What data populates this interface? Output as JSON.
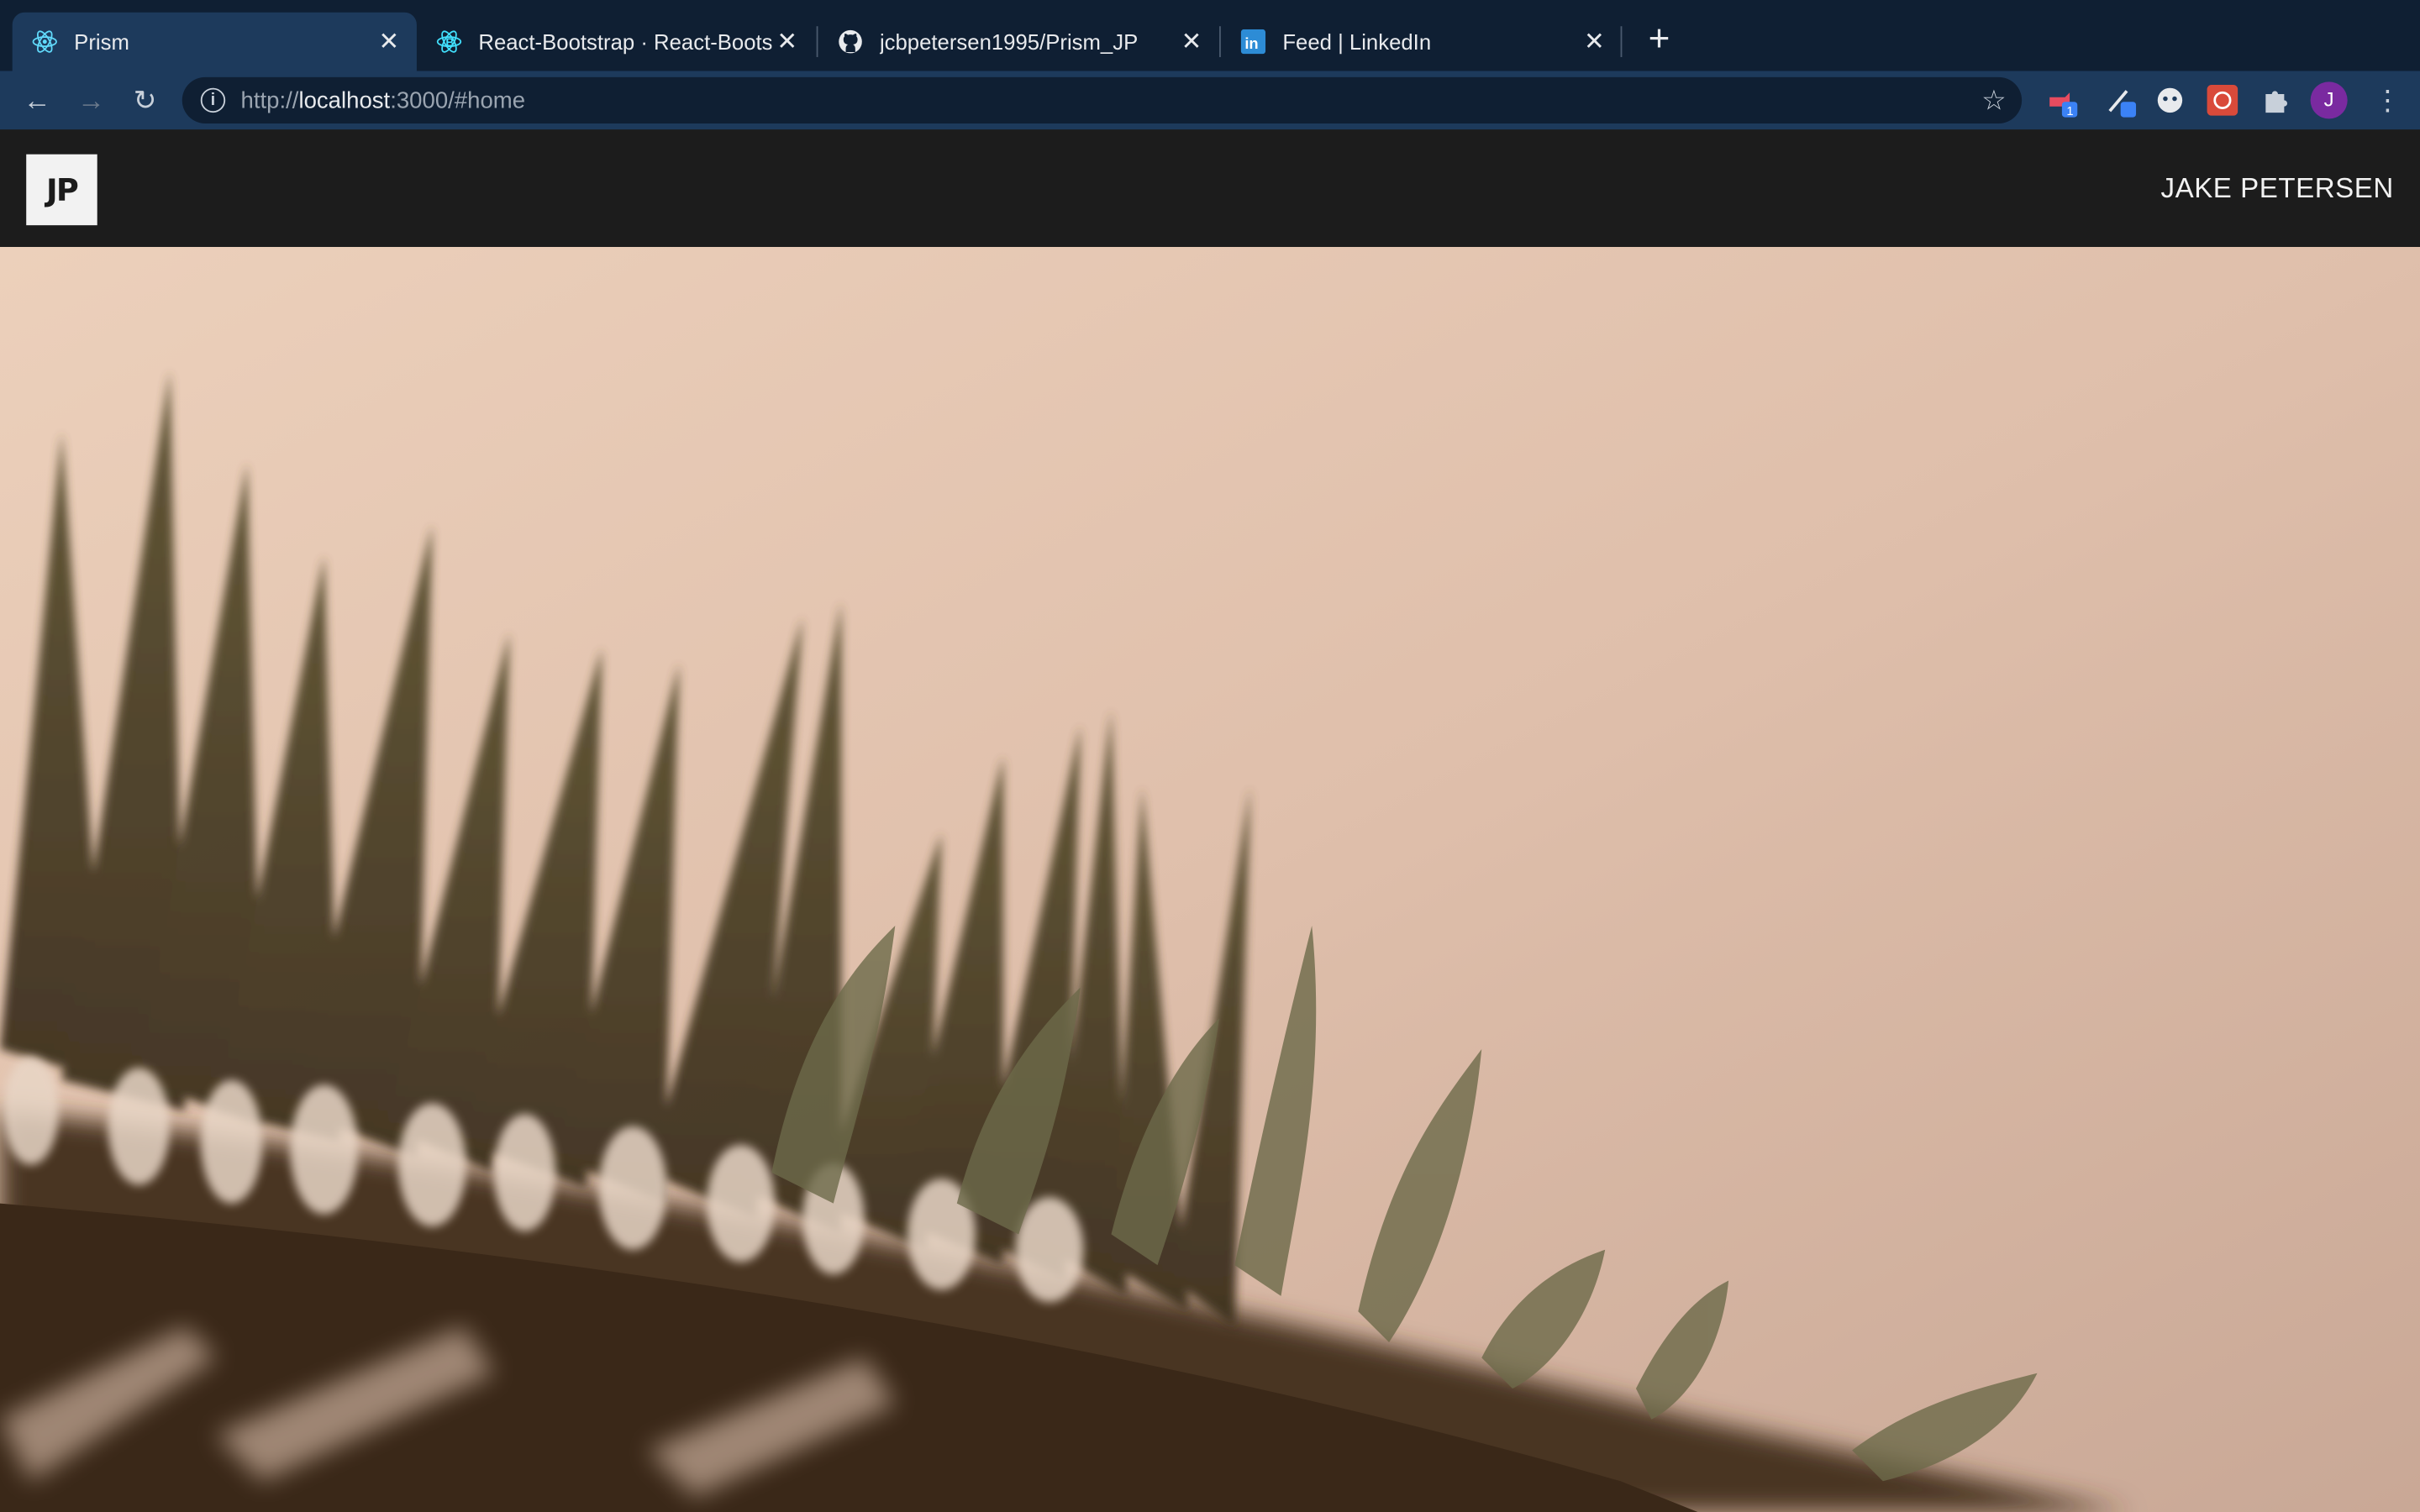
{
  "browser": {
    "tabs": [
      {
        "title": "Prism",
        "active": true,
        "icon": "react-icon"
      },
      {
        "title": "React-Bootstrap · React-Boots",
        "active": false,
        "icon": "react-bootstrap-icon"
      },
      {
        "title": "jcbpetersen1995/Prism_JP",
        "active": false,
        "icon": "github-icon"
      },
      {
        "title": "Feed | LinkedIn",
        "active": false,
        "icon": "linkedin-icon"
      }
    ],
    "url_scheme": "http://",
    "url_host": "localhost",
    "url_rest": ":3000/#home",
    "avatar_initial": "J"
  },
  "site": {
    "logo_text": "JP",
    "brand_name": "JAKE PETERSEN"
  },
  "colors": {
    "tabbar": "#0f1f33",
    "toolbar": "#1d3a5c",
    "navbar": "#1c1c1c",
    "hero_sky": "#e6c6b0"
  }
}
